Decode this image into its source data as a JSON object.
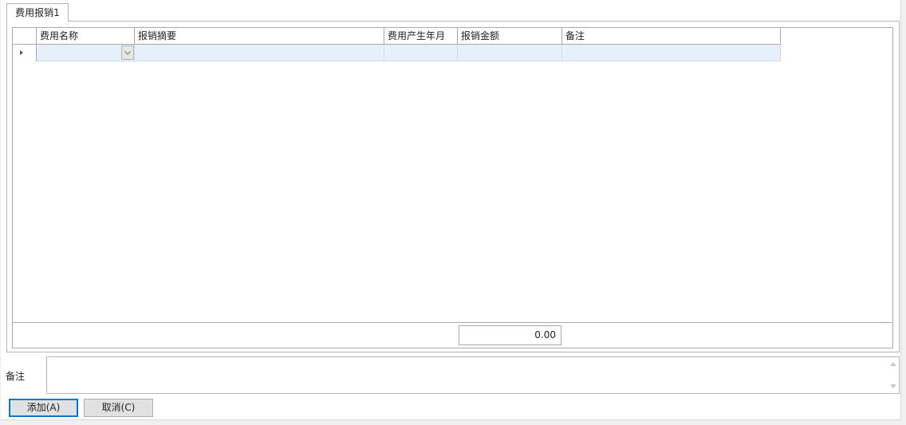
{
  "tab": {
    "label": "费用报销1"
  },
  "grid": {
    "columns": [
      "费用名称",
      "报销摘要",
      "费用产生年月",
      "报销金额",
      "备注"
    ],
    "rows": [
      {
        "expense_name": "",
        "summary": "",
        "year_month": "",
        "amount": "",
        "note": ""
      }
    ],
    "total_amount": "0.00"
  },
  "remark": {
    "label": "备注",
    "value": ""
  },
  "buttons": {
    "add": "添加(A)",
    "cancel": "取消(C)"
  },
  "icons": {
    "row_indicator": "triangle-right-icon",
    "combo": "chevron-down-icon",
    "scroll_up": "scroll-up-icon",
    "scroll_down": "scroll-down-icon"
  },
  "colors": {
    "selected_row": "#e5f0fb",
    "default_button_border": "#0078d7"
  }
}
